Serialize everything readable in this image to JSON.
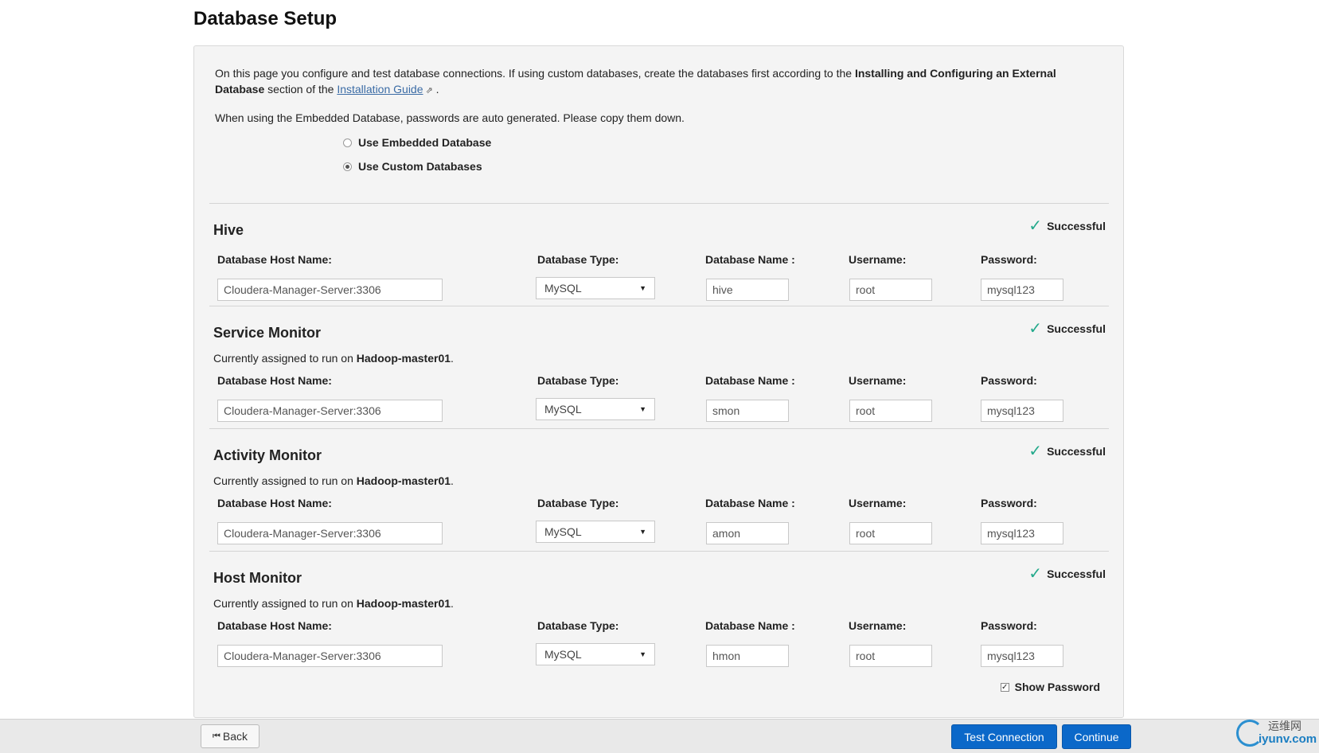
{
  "page": {
    "title": "Database Setup"
  },
  "intro": {
    "text_before": "On this page you configure and test database connections. If using custom databases, create the databases first according to the ",
    "bold_ref": "Installing and Configuring an External Database",
    "text_middle": " section of the ",
    "link_label": "Installation Guide",
    "text_after": " .",
    "note": "When using the Embedded Database, passwords are auto generated. Please copy them down."
  },
  "options": [
    {
      "label": "Use Embedded Database",
      "selected": false
    },
    {
      "label": "Use Custom Databases",
      "selected": true
    }
  ],
  "field_labels": {
    "host": "Database Host Name:",
    "type": "Database Type:",
    "dbname": "Database Name :",
    "username": "Username:",
    "password": "Password:"
  },
  "assigned_prefix": "Currently assigned to run on ",
  "sections": [
    {
      "title": "Hive",
      "status": "Successful",
      "assigned_host": "",
      "host": "Cloudera-Manager-Server:3306",
      "type": "MySQL",
      "dbname": "hive",
      "username": "root",
      "password": "mysql123"
    },
    {
      "title": "Service Monitor",
      "status": "Successful",
      "assigned_host": "Hadoop-master01",
      "host": "Cloudera-Manager-Server:3306",
      "type": "MySQL",
      "dbname": "smon",
      "username": "root",
      "password": "mysql123"
    },
    {
      "title": "Activity Monitor",
      "status": "Successful",
      "assigned_host": "Hadoop-master01",
      "host": "Cloudera-Manager-Server:3306",
      "type": "MySQL",
      "dbname": "amon",
      "username": "root",
      "password": "mysql123"
    },
    {
      "title": "Host Monitor",
      "status": "Successful",
      "assigned_host": "Hadoop-master01",
      "host": "Cloudera-Manager-Server:3306",
      "type": "MySQL",
      "dbname": "hmon",
      "username": "root",
      "password": "mysql123"
    }
  ],
  "show_password": {
    "label": "Show Password",
    "checked": true
  },
  "footer": {
    "back_label": "Back",
    "test_label": "Test Connection",
    "continue_label": "Continue"
  },
  "watermark": {
    "cn": "运维网",
    "en": "iyunv.com"
  },
  "colors": {
    "primary": "#0b68c9",
    "success": "#23a98b",
    "link": "#3a6ba5"
  }
}
